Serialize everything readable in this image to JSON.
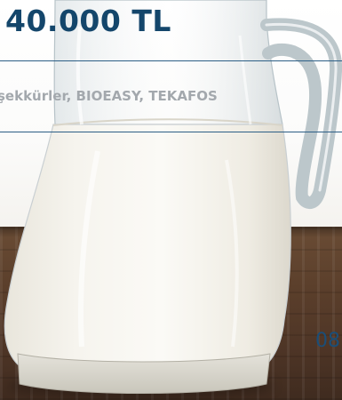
{
  "price": "40.000 TL",
  "tags": "şekkürler, BIOEASY, TEKAFOS",
  "date_fragment": "08",
  "image": {
    "alt": "",
    "subject-icon": "milk-jug-icon"
  },
  "colors": {
    "price": "#14466b",
    "tags": "#a3a8ad",
    "rule": "#2d5f86",
    "date": "#1a4e78"
  }
}
